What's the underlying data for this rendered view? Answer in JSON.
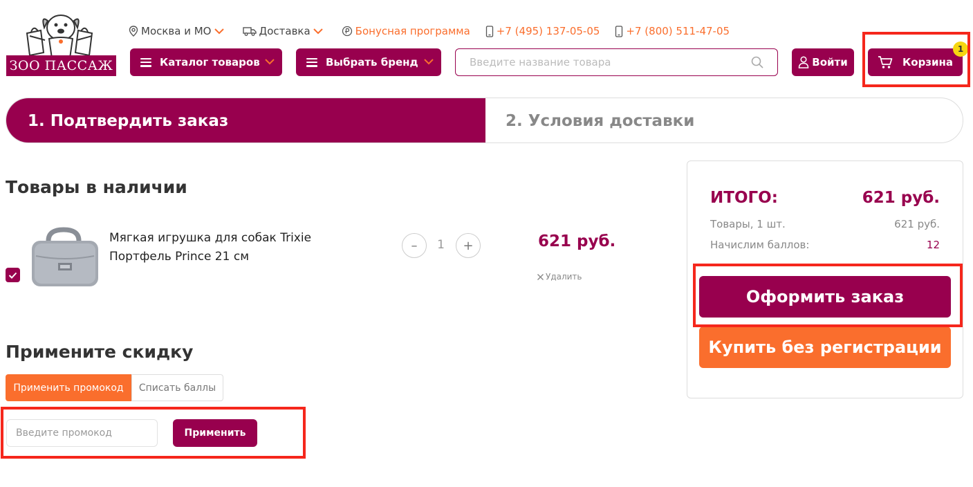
{
  "brand": {
    "logo_text": "ЗОО ПАССАЖ",
    "color": "#98004e",
    "accent": "#fa6e2d"
  },
  "topbar": {
    "region": "Москва и МО",
    "delivery": "Доставка",
    "bonus": "Бонусная программа",
    "phone1": "+7 (495) 137-05-05",
    "phone2": "+7 (800) 511-47-05"
  },
  "header": {
    "catalog_label": "Каталог товаров",
    "brand_label": "Выбрать бренд",
    "search_placeholder": "Введите название товара",
    "login_label": "Войти",
    "cart_label": "Корзина",
    "cart_count": "1"
  },
  "steps": {
    "step1": "1. Подтвердить заказ",
    "step2": "2. Условия доставки"
  },
  "products": {
    "title": "Товары в наличии",
    "items": [
      {
        "name": "Мягкая игрушка для собак Trixie Портфель Prince 21 см",
        "quantity": "1",
        "price": "621 руб.",
        "remove_label": "Удалить",
        "minus": "–",
        "plus": "+"
      }
    ]
  },
  "discount": {
    "title": "Примените скидку",
    "tab_promo": "Применить промокод",
    "tab_points": "Списать баллы",
    "input_placeholder": "Введите промокод",
    "apply_label": "Применить"
  },
  "summary": {
    "total_label": "ИТОГО:",
    "total_value": "621 руб.",
    "goods_label": "Товары, 1 шт.",
    "goods_value": "621 руб.",
    "points_label": "Начислим баллов:",
    "points_value": "12",
    "checkout_label": "Оформить заказ",
    "quickbuy_label": "Купить без регистрации"
  }
}
